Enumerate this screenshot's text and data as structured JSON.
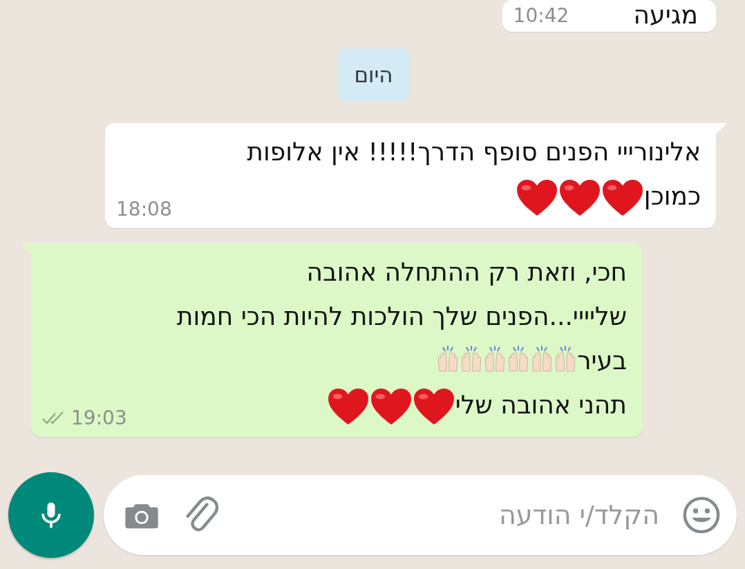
{
  "messages": [
    {
      "kind": "incoming",
      "lines": [
        {
          "text": "מגיעה"
        }
      ],
      "time": "10:42"
    },
    {
      "kind": "date",
      "text": "היום"
    },
    {
      "kind": "incoming",
      "lines": [
        {
          "text": "אלינורייי הפנים סופף הדרך!!!!! אין אלופות"
        },
        {
          "text": "כמוכן",
          "emoji": [
            {
              "kind": "heart"
            },
            {
              "kind": "heart"
            },
            {
              "kind": "heart"
            }
          ]
        }
      ],
      "time": "18:08"
    },
    {
      "kind": "outgoing",
      "lines": [
        {
          "text": "חכי, וזאת רק ההתחלה אהובה"
        },
        {
          "text": "שליייי...הפנים שלך הולכות להיות הכי חמות"
        },
        {
          "text": "בעיר",
          "emoji": [
            {
              "kind": "raised-hands"
            },
            {
              "kind": "raised-hands"
            },
            {
              "kind": "raised-hands"
            },
            {
              "kind": "raised-hands"
            },
            {
              "kind": "raised-hands"
            },
            {
              "kind": "raised-hands"
            }
          ]
        },
        {
          "text": "תהני אהובה שלי",
          "emoji": [
            {
              "kind": "heart"
            },
            {
              "kind": "heart"
            },
            {
              "kind": "heart"
            }
          ]
        }
      ],
      "time": "19:03",
      "read": false
    }
  ],
  "composer": {
    "placeholder": "הקלד/י הודעה"
  }
}
